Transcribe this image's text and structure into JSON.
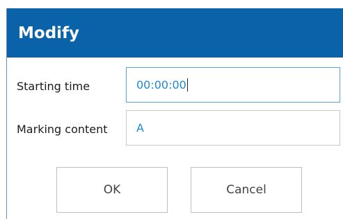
{
  "dialog": {
    "title": "Modify",
    "fields": {
      "starting_time": {
        "label": "Starting time",
        "value": "00:00:00"
      },
      "marking_content": {
        "label": "Marking content",
        "value": "A"
      }
    },
    "buttons": {
      "ok_label": "OK",
      "cancel_label": "Cancel"
    }
  },
  "colors": {
    "titlebar": "#0a63a8",
    "input_text": "#1c8ad6"
  }
}
